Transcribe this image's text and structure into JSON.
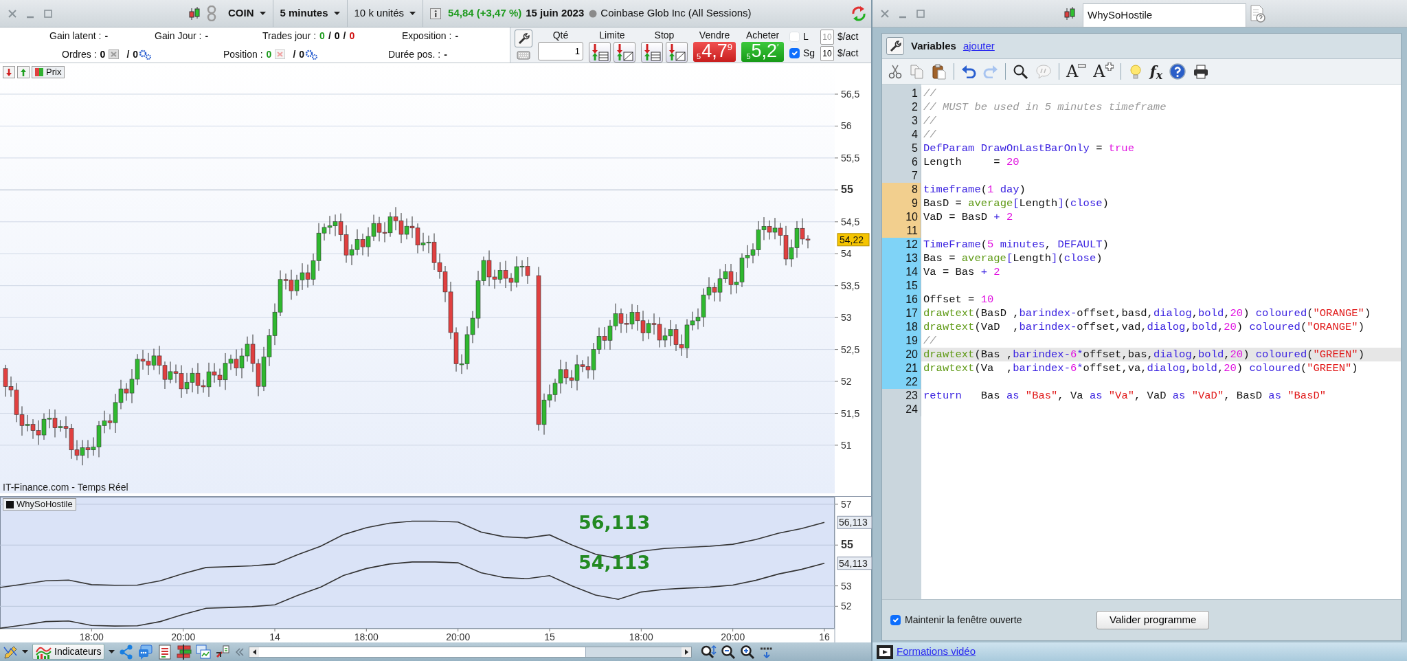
{
  "chart_window": {
    "title_bar": {
      "symbol": "COIN",
      "timeframe": "5 minutes",
      "quantity": "10 k unités",
      "change": "54,84 (+3,47 %)",
      "date": "15 juin 2023",
      "instrument": "Coinbase Glob Inc (All Sessions)"
    },
    "stat_rows": [
      {
        "items": [
          {
            "kind": "value",
            "label": "Gain latent :",
            "value": "-"
          },
          {
            "kind": "value",
            "label": "Gain Jour :",
            "value": "-"
          },
          {
            "kind": "counts",
            "label": "Trades jour :",
            "separator": "/",
            "counts": [
              {
                "text": "0",
                "color": "#1a9a1a"
              },
              {
                "text": "0",
                "color": "#000000"
              },
              {
                "text": "0",
                "color": "#d01010"
              }
            ]
          },
          {
            "kind": "value",
            "label": "Exposition :",
            "value": "-"
          }
        ]
      },
      {
        "items": [
          {
            "kind": "orders",
            "label": "Ordres :",
            "count": "0",
            "color": "#000000",
            "separator": "/",
            "pending": "0"
          },
          {
            "kind": "orders",
            "label": "Position :",
            "count": "0",
            "color": "#1a9a1a",
            "separator": "/",
            "pending": "0"
          },
          {
            "kind": "value",
            "label": "Durée pos. :",
            "value": "-"
          }
        ]
      }
    ],
    "order_panel": {
      "quantity_label": "Qté",
      "quantity": "1",
      "limit_label": "Limite",
      "stop_label": "Stop",
      "sell": {
        "label": "Vendre",
        "prefix": "5",
        "price": "4,7",
        "suffix": "9"
      },
      "buy": {
        "label": "Acheter",
        "prefix": "5",
        "price": "5,2",
        "suffix": "′"
      },
      "options": [
        {
          "label": "L",
          "checked": false,
          "value": "10",
          "disabled": true,
          "unit": "$/act"
        },
        {
          "label": "Sg",
          "checked": true,
          "value": "10",
          "disabled": false,
          "unit": "$/act"
        }
      ]
    },
    "price_chart": {
      "legend": "Prix",
      "current_price": "54,22",
      "source": "IT-Finance.com - Temps Réel",
      "y_axis": [
        {
          "label": "56,5",
          "major": false
        },
        {
          "label": "56",
          "major": false
        },
        {
          "label": "55,5",
          "major": false
        },
        {
          "label": "55",
          "major": true
        },
        {
          "label": "54,5",
          "major": false
        },
        {
          "label": "54",
          "major": false
        },
        {
          "label": "53,5",
          "major": false
        },
        {
          "label": "53",
          "major": false
        },
        {
          "label": "52,5",
          "major": false
        },
        {
          "label": "52",
          "major": false
        },
        {
          "label": "51,5",
          "major": false
        },
        {
          "label": "51",
          "major": false
        }
      ]
    },
    "indicator": {
      "legend": "WhySoHostile",
      "last_value_labels": [
        "56,113",
        "54,113"
      ],
      "chart_data": {
        "type": "line",
        "ylim": [
          50.9,
          57.4
        ],
        "grid": true,
        "categories": [
          null,
          null,
          null,
          null,
          "18:00",
          null,
          null,
          null,
          "20:00",
          null,
          null,
          null,
          "14",
          null,
          null,
          null,
          "18:00",
          null,
          null,
          null,
          "20:00",
          null,
          null,
          null,
          "15",
          null,
          null,
          null,
          "18:00",
          null,
          null,
          null,
          "20:00",
          null,
          null,
          null,
          "16"
        ],
        "series": [
          {
            "color": "#333333",
            "values": [
              52.92,
              53.08,
              53.25,
              53.28,
              53.06,
              53.03,
              53.04,
              53.25,
              53.6,
              53.9,
              53.94,
              53.98,
              54.07,
              54.53,
              54.94,
              55.51,
              55.85,
              56.07,
              56.17,
              56.17,
              56.13,
              55.64,
              55.41,
              55.35,
              55.5,
              54.99,
              54.55,
              54.34,
              54.7,
              54.83,
              54.89,
              54.94,
              55.04,
              55.27,
              55.58,
              55.81,
              56.11
            ]
          },
          {
            "color": "#333333",
            "values": [
              50.92,
              51.08,
              51.25,
              51.28,
              51.06,
              51.03,
              51.04,
              51.25,
              51.6,
              51.9,
              51.94,
              51.98,
              52.07,
              52.53,
              52.94,
              53.51,
              53.85,
              54.07,
              54.17,
              54.17,
              54.13,
              53.64,
              53.41,
              53.35,
              53.5,
              52.99,
              52.55,
              52.34,
              52.7,
              52.83,
              52.89,
              52.94,
              53.04,
              53.27,
              53.58,
              53.81,
              54.11
            ]
          }
        ],
        "yticks": [
          {
            "value": 57,
            "label": "57"
          },
          {
            "value": 55,
            "label": "55"
          },
          {
            "value": 53,
            "label": "53"
          },
          {
            "value": 52,
            "label": "52"
          }
        ],
        "annotations": [
          "56,113",
          "54,113"
        ]
      }
    },
    "bottom_toolbar": {
      "indicators_button": "Indicateurs"
    }
  },
  "editor_window": {
    "tab": "WhySoHostile",
    "variables_label": "Variables",
    "add_link": "ajouter",
    "font_buttons": [
      "A",
      "A"
    ],
    "function_button": "f$_{x}$",
    "code_lines": [
      {
        "number": "1",
        "selected": false,
        "tokens": [
          {
            "kind": "comment",
            "text": "//"
          }
        ]
      },
      {
        "number": "2",
        "selected": false,
        "tokens": [
          {
            "kind": "comment",
            "text": "// MUST be used in 5 minutes timeframe"
          }
        ]
      },
      {
        "number": "3",
        "selected": false,
        "tokens": [
          {
            "kind": "comment",
            "text": "//"
          }
        ]
      },
      {
        "number": "4",
        "selected": false,
        "tokens": [
          {
            "kind": "comment",
            "text": "//"
          }
        ]
      },
      {
        "number": "5",
        "selected": false,
        "tokens": [
          {
            "kind": "keyword",
            "text": "DefParam "
          },
          {
            "kind": "keyword",
            "text": "DrawOnLastBarOnly"
          },
          {
            "kind": "plain",
            "text": " = "
          },
          {
            "kind": "number",
            "text": "true"
          }
        ]
      },
      {
        "number": "6",
        "selected": false,
        "tokens": [
          {
            "kind": "plain",
            "text": "Length     = "
          },
          {
            "kind": "number",
            "text": "20"
          }
        ]
      },
      {
        "number": "7",
        "selected": false
      },
      {
        "number": "8",
        "selected": false,
        "color": "#f2cf8e",
        "tokens": [
          {
            "kind": "keyword",
            "text": "timeframe"
          },
          {
            "kind": "plain",
            "text": "("
          },
          {
            "kind": "number",
            "text": "1 "
          },
          {
            "kind": "keyword",
            "text": "day"
          },
          {
            "kind": "plain",
            "text": ")"
          }
        ]
      },
      {
        "number": "9",
        "selected": false,
        "color": "#f2cf8e",
        "tokens": [
          {
            "kind": "plain",
            "text": "BasD = "
          },
          {
            "kind": "function",
            "text": "average"
          },
          {
            "kind": "keyword",
            "text": "["
          },
          {
            "kind": "plain",
            "text": "Length"
          },
          {
            "kind": "keyword",
            "text": "]"
          },
          {
            "kind": "plain",
            "text": "("
          },
          {
            "kind": "keyword",
            "text": "close"
          },
          {
            "kind": "plain",
            "text": ")"
          }
        ]
      },
      {
        "number": "10",
        "selected": false,
        "color": "#f2cf8e",
        "tokens": [
          {
            "kind": "plain",
            "text": "VaD = BasD "
          },
          {
            "kind": "keyword",
            "text": "+ "
          },
          {
            "kind": "number",
            "text": "2"
          }
        ]
      },
      {
        "number": "11",
        "selected": false,
        "color": "#f2cf8e"
      },
      {
        "number": "12",
        "selected": false,
        "color": "#7fd3f7",
        "tokens": [
          {
            "kind": "keyword",
            "text": "TimeFrame"
          },
          {
            "kind": "plain",
            "text": "("
          },
          {
            "kind": "number",
            "text": "5 "
          },
          {
            "kind": "keyword",
            "text": "minutes"
          },
          {
            "kind": "plain",
            "text": ", "
          },
          {
            "kind": "keyword",
            "text": "DEFAULT"
          },
          {
            "kind": "plain",
            "text": ")"
          }
        ]
      },
      {
        "number": "13",
        "selected": false,
        "color": "#7fd3f7",
        "tokens": [
          {
            "kind": "plain",
            "text": "Bas = "
          },
          {
            "kind": "function",
            "text": "average"
          },
          {
            "kind": "keyword",
            "text": "["
          },
          {
            "kind": "plain",
            "text": "Length"
          },
          {
            "kind": "keyword",
            "text": "]"
          },
          {
            "kind": "plain",
            "text": "("
          },
          {
            "kind": "keyword",
            "text": "close"
          },
          {
            "kind": "plain",
            "text": ")"
          }
        ]
      },
      {
        "number": "14",
        "selected": false,
        "color": "#7fd3f7",
        "tokens": [
          {
            "kind": "plain",
            "text": "Va = Bas "
          },
          {
            "kind": "keyword",
            "text": "+ "
          },
          {
            "kind": "number",
            "text": "2"
          }
        ]
      },
      {
        "number": "15",
        "selected": false,
        "color": "#7fd3f7"
      },
      {
        "number": "16",
        "selected": false,
        "color": "#7fd3f7",
        "tokens": [
          {
            "kind": "plain",
            "text": "Offset = "
          },
          {
            "kind": "number",
            "text": "10"
          }
        ]
      },
      {
        "number": "17",
        "selected": false,
        "color": "#7fd3f7",
        "tokens": [
          {
            "kind": "function",
            "text": "drawtext"
          },
          {
            "kind": "plain",
            "text": "(BasD ,"
          },
          {
            "kind": "keyword",
            "text": "barindex-"
          },
          {
            "kind": "plain",
            "text": "offset,basd,"
          },
          {
            "kind": "keyword",
            "text": "dialog"
          },
          {
            "kind": "plain",
            "text": ","
          },
          {
            "kind": "keyword",
            "text": "bold"
          },
          {
            "kind": "plain",
            "text": ","
          },
          {
            "kind": "number",
            "text": "20"
          },
          {
            "kind": "plain",
            "text": ") "
          },
          {
            "kind": "keyword",
            "text": "coloured"
          },
          {
            "kind": "plain",
            "text": "("
          },
          {
            "kind": "string",
            "text": "\"ORANGE\""
          },
          {
            "kind": "plain",
            "text": ")"
          }
        ]
      },
      {
        "number": "18",
        "selected": false,
        "color": "#7fd3f7",
        "tokens": [
          {
            "kind": "function",
            "text": "drawtext"
          },
          {
            "kind": "plain",
            "text": "(VaD  ,"
          },
          {
            "kind": "keyword",
            "text": "barindex-"
          },
          {
            "kind": "plain",
            "text": "offset,vad,"
          },
          {
            "kind": "keyword",
            "text": "dialog"
          },
          {
            "kind": "plain",
            "text": ","
          },
          {
            "kind": "keyword",
            "text": "bold"
          },
          {
            "kind": "plain",
            "text": ","
          },
          {
            "kind": "number",
            "text": "20"
          },
          {
            "kind": "plain",
            "text": ") "
          },
          {
            "kind": "keyword",
            "text": "coloured"
          },
          {
            "kind": "plain",
            "text": "("
          },
          {
            "kind": "string",
            "text": "\"ORANGE\""
          },
          {
            "kind": "plain",
            "text": ")"
          }
        ]
      },
      {
        "number": "19",
        "selected": false,
        "color": "#7fd3f7",
        "tokens": [
          {
            "kind": "comment",
            "text": "//"
          }
        ]
      },
      {
        "number": "20",
        "selected": true,
        "color": "#7fd3f7",
        "tokens": [
          {
            "kind": "function",
            "text": "drawtext"
          },
          {
            "kind": "plain",
            "text": "(Bas ,"
          },
          {
            "kind": "keyword",
            "text": "barindex-"
          },
          {
            "kind": "number",
            "text": "6"
          },
          {
            "kind": "keyword",
            "text": "*"
          },
          {
            "kind": "plain",
            "text": "offset,bas,"
          },
          {
            "kind": "keyword",
            "text": "dialog"
          },
          {
            "kind": "plain",
            "text": ","
          },
          {
            "kind": "keyword",
            "text": "bold"
          },
          {
            "kind": "plain",
            "text": ","
          },
          {
            "kind": "number",
            "text": "20"
          },
          {
            "kind": "plain",
            "text": ") "
          },
          {
            "kind": "keyword",
            "text": "coloured"
          },
          {
            "kind": "plain",
            "text": "("
          },
          {
            "kind": "string",
            "text": "\"GREEN\""
          },
          {
            "kind": "plain",
            "text": ")"
          }
        ]
      },
      {
        "number": "21",
        "selected": false,
        "color": "#7fd3f7",
        "tokens": [
          {
            "kind": "function",
            "text": "drawtext"
          },
          {
            "kind": "plain",
            "text": "(Va  ,"
          },
          {
            "kind": "keyword",
            "text": "barindex-"
          },
          {
            "kind": "number",
            "text": "6"
          },
          {
            "kind": "keyword",
            "text": "*"
          },
          {
            "kind": "plain",
            "text": "offset,va,"
          },
          {
            "kind": "keyword",
            "text": "dialog"
          },
          {
            "kind": "plain",
            "text": ","
          },
          {
            "kind": "keyword",
            "text": "bold"
          },
          {
            "kind": "plain",
            "text": ","
          },
          {
            "kind": "number",
            "text": "20"
          },
          {
            "kind": "plain",
            "text": ") "
          },
          {
            "kind": "keyword",
            "text": "coloured"
          },
          {
            "kind": "plain",
            "text": "("
          },
          {
            "kind": "string",
            "text": "\"GREEN\""
          },
          {
            "kind": "plain",
            "text": ")"
          }
        ]
      },
      {
        "number": "22",
        "selected": false,
        "color": "#7fd3f7"
      },
      {
        "number": "23",
        "selected": false,
        "tokens": [
          {
            "kind": "keyword",
            "text": "return"
          },
          {
            "kind": "plain",
            "text": "   Bas "
          },
          {
            "kind": "keyword",
            "text": "as "
          },
          {
            "kind": "string",
            "text": "\"Bas\""
          },
          {
            "kind": "plain",
            "text": ", Va "
          },
          {
            "kind": "keyword",
            "text": "as "
          },
          {
            "kind": "string",
            "text": "\"Va\""
          },
          {
            "kind": "plain",
            "text": ", VaD "
          },
          {
            "kind": "keyword",
            "text": "as "
          },
          {
            "kind": "string",
            "text": "\"VaD\""
          },
          {
            "kind": "plain",
            "text": ", BasD "
          },
          {
            "kind": "keyword",
            "text": "as "
          },
          {
            "kind": "string",
            "text": "\"BasD\""
          }
        ]
      },
      {
        "number": "24",
        "selected": false
      }
    ],
    "keep_open": {
      "label": "Maintenir la fenêtre ouverte",
      "checked": true
    },
    "validate_button": "Valider programme",
    "footer_link": "Formations vidéo"
  }
}
